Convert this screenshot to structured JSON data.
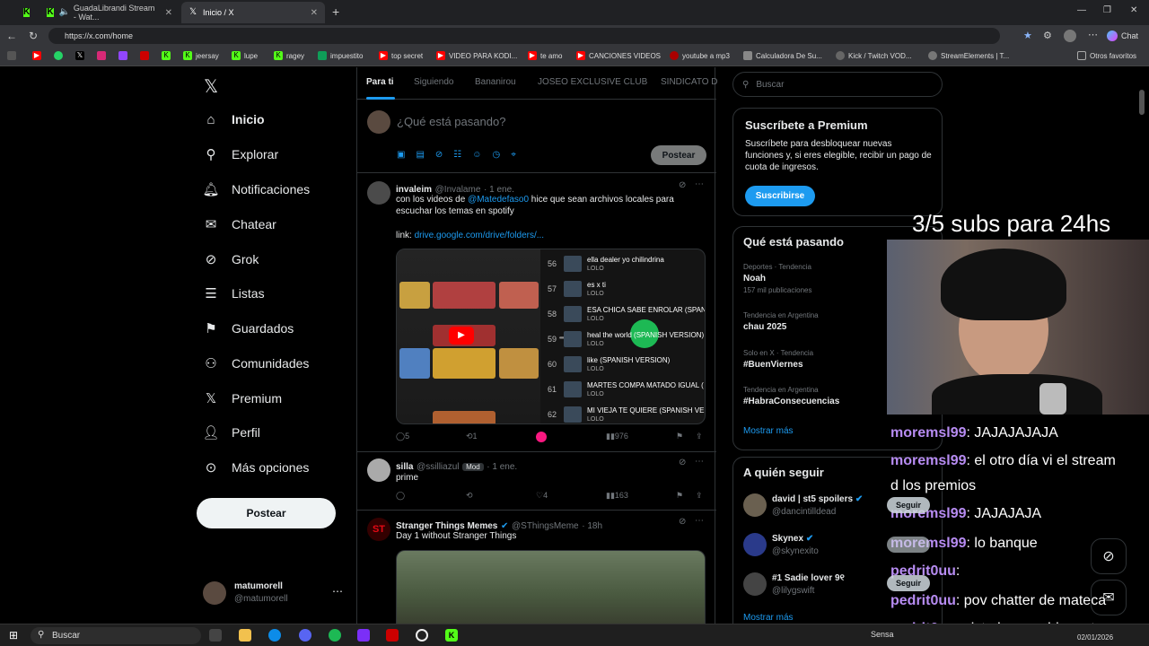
{
  "browser": {
    "tabs": [
      {
        "title": "GuadaLibrandi Stream - Wat..."
      },
      {
        "title": "Inicio / X"
      }
    ],
    "url": "https://x.com/home",
    "bookmarks": [
      "jeersay",
      "lupe",
      "ragey",
      "impuestito",
      "top secret",
      "VIDEO PARA KODI...",
      "te amo",
      "CANCIONES VIDEOS",
      "youtube a mp3",
      "Calculadora De Su...",
      "Kick / Twitch VOD...",
      "StreamElements | T...",
      "Otros favoritos"
    ],
    "chat_button": "Chat"
  },
  "nav": {
    "items": [
      "Inicio",
      "Explorar",
      "Notificaciones",
      "Chatear",
      "Grok",
      "Listas",
      "Guardados",
      "Comunidades",
      "Premium",
      "Perfil",
      "Más opciones"
    ],
    "post_button": "Postear",
    "user": {
      "name": "matumorell",
      "handle": "@matumorell"
    }
  },
  "feed": {
    "tabs": [
      "Para ti",
      "Siguiendo",
      "Bananirou",
      "JOSEO EXCLUSIVE CLUB",
      "SINDICATO D"
    ],
    "composer_placeholder": "¿Qué está pasando?",
    "composer_post": "Postear",
    "tweets": [
      {
        "name": "invaleim",
        "handle": "@Invalame",
        "time": "· 1 ene.",
        "text1": "con los videos de ",
        "mention": "@Matedefaso0",
        "text2": " hice que sean archivos locales para escuchar los temas en spotify",
        "link_label": "link: ",
        "link": "drive.google.com/drive/folders/...",
        "playlist": [
          {
            "n": "56",
            "title": "ella dealer yo chilindrina",
            "artist": "LOLO"
          },
          {
            "n": "57",
            "title": "es x ti",
            "artist": "LOLO"
          },
          {
            "n": "58",
            "title": "ESA CHICA SABE ENROLAR (SPANIS",
            "artist": "LOLO"
          },
          {
            "n": "59",
            "title": "heal the world (SPANISH VERSION)",
            "artist": "LOLO"
          },
          {
            "n": "60",
            "title": "like (SPANISH VERSION)",
            "artist": "LOLO"
          },
          {
            "n": "61",
            "title": "MARTES COMPA MATADO IGUAL ( p",
            "artist": "LOLO"
          },
          {
            "n": "62",
            "title": "MI VIEJA TE QUIERE (SPANISH VERS",
            "artist": "LOLO"
          }
        ],
        "replies": "5",
        "reposts": "1",
        "views": "976"
      },
      {
        "name": "silla",
        "handle": "@ssilliazul",
        "badge": "Mod",
        "time": "· 1 ene.",
        "text": "prime",
        "likes": "4",
        "views": "163"
      },
      {
        "name": "Stranger Things Memes",
        "handle": "@SThingsMeme",
        "time": "· 18h",
        "text": "Day 1 without Stranger Things"
      }
    ]
  },
  "right": {
    "search_placeholder": "Buscar",
    "premium": {
      "title": "Suscríbete a Premium",
      "body": "Suscríbete para desbloquear nuevas funciones y, si eres elegible, recibir un pago de cuota de ingresos.",
      "button": "Suscribirse"
    },
    "trends": {
      "title": "Qué está pasando",
      "items": [
        {
          "cat": "Deportes · Tendencia",
          "title": "Noah",
          "count": "157 mil publicaciones"
        },
        {
          "cat": "Tendencia en Argentina",
          "title": "chau 2025",
          "count": ""
        },
        {
          "cat": "Solo en X · Tendencia",
          "title": "#BuenViernes",
          "count": ""
        },
        {
          "cat": "Tendencia en Argentina",
          "title": "#HabraConsecuencias",
          "count": ""
        }
      ],
      "more": "Mostrar más"
    },
    "follow": {
      "title": "A quién seguir",
      "items": [
        {
          "name": "david | st5 spoilers",
          "handle": "@dancintilldead"
        },
        {
          "name": "Skynex",
          "handle": "@skynexito"
        },
        {
          "name": "#1 Sadie lover 9୧",
          "handle": "@lilygswift"
        }
      ],
      "button": "Seguir",
      "more": "Mostrar más"
    }
  },
  "overlay": {
    "goal": "3/5 subs para 24hs",
    "chat": [
      {
        "user": "moremsl99",
        "msg": ": JAJAJAJAJA"
      },
      {
        "user": "moremsl99",
        "msg": ": el otro día vi el stream"
      },
      {
        "user": "",
        "msg": "d los premios"
      },
      {
        "user": "moremsl99",
        "msg": ": JAJAJAJA"
      },
      {
        "user": "moremsl99",
        "msg": ": lo banque"
      },
      {
        "user": "pedrit0uu",
        "msg": ":"
      },
      {
        "user": "pedrit0uu",
        "msg": ": pov chatter de mateca"
      },
      {
        "user": "pedrit0uu",
        "msg": ": viste lo qe subio mate"
      }
    ]
  },
  "taskbar": {
    "search": "Buscar",
    "weather": "Sensa",
    "date": "02/01/2026"
  },
  "colors": {
    "accent": "#1d9bf0",
    "chat_user": "#b78cf2",
    "bg": "#000000"
  }
}
